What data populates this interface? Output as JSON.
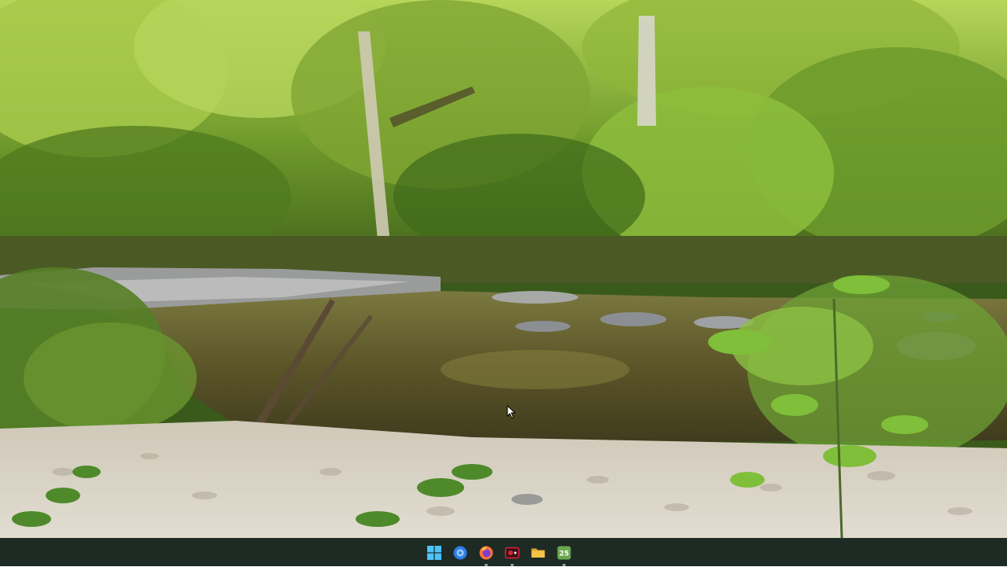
{
  "wallpaper": {
    "description_icon": "forest-creek-wallpaper",
    "colors": {
      "foliage_light": "#9cc23e",
      "foliage_dark": "#3d5e1a",
      "water": "#5a5a2a",
      "gravel": "#d9d4c7",
      "rock": "#8b8f93"
    }
  },
  "taskbar": {
    "background": "#1e2a24",
    "items": [
      {
        "name": "start-button",
        "icon": "windows-logo-icon",
        "color": "#4cc2ff"
      },
      {
        "name": "taskbar-app-1",
        "icon": "app-blue-circle-icon",
        "color": "#2f7ee6"
      },
      {
        "name": "taskbar-firefox",
        "icon": "firefox-icon",
        "color": "#ff7139"
      },
      {
        "name": "taskbar-recorder",
        "icon": "screen-recorder-icon",
        "color": "#d9243a"
      },
      {
        "name": "taskbar-file-explorer",
        "icon": "folder-icon",
        "color": "#f6c445"
      },
      {
        "name": "taskbar-app-25",
        "icon": "green-app-icon",
        "color": "#6aa84f",
        "badge": "25"
      }
    ]
  }
}
